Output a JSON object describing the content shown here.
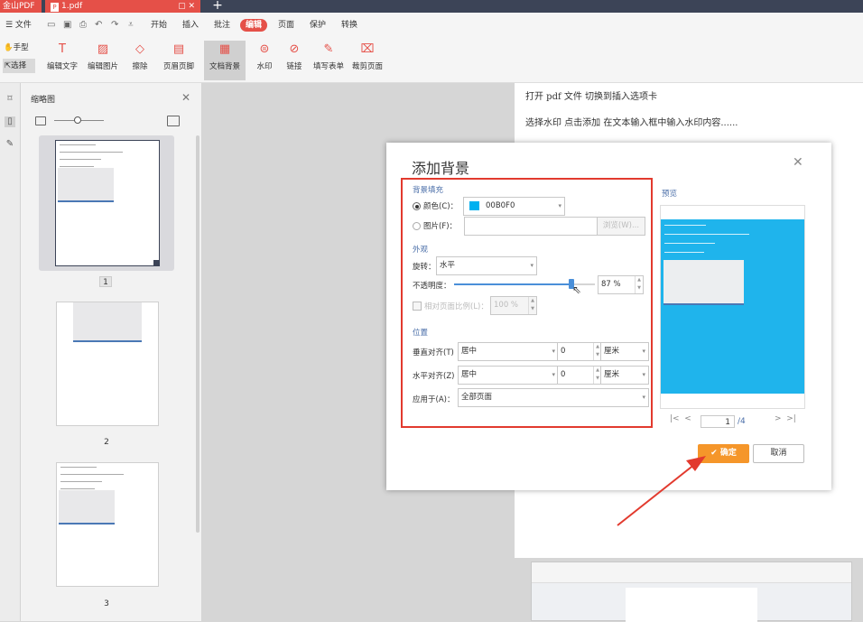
{
  "titlebar": {
    "app_name": "金山PDF",
    "file_name": "1.pdf",
    "file_icon": "P",
    "window_controls": "▢ ✕",
    "new_tab": "+"
  },
  "menubar": {
    "file_menu": "☰ 文件",
    "items": [
      "开始",
      "插入",
      "批注",
      "编辑",
      "页面",
      "保护",
      "转换"
    ]
  },
  "ribbon": {
    "hand": "手型",
    "select": "选择",
    "buttons": [
      "编辑文字",
      "编辑图片",
      "擦除",
      "页眉页脚",
      "文档背景",
      "水印",
      "链接",
      "填写表单",
      "裁剪页面"
    ]
  },
  "thumbnails": {
    "title": "缩略图",
    "pages": [
      "1",
      "2",
      "3"
    ]
  },
  "document": {
    "line1": "打开 pdf 文件  切换到插入选项卡",
    "line2": "选择水印    点击添加  在文本输入框中输入水印内容......"
  },
  "dialog": {
    "title": "添加背景",
    "fill_section": "背景填充",
    "color_label": "颜色(C)：",
    "color_value": "00B0F0",
    "color_hex": "#00B0F0",
    "image_label": "图片(F)：",
    "browse_label": "浏览(W)...",
    "appearance_section": "外观",
    "rotate_label": "旋转：",
    "rotate_value": "水平",
    "opacity_label": "不透明度：",
    "opacity_value": "87 %",
    "opacity_fraction": 0.87,
    "relative_label": "相对页面比例(L)：",
    "relative_value": "100 %",
    "position_section": "位置",
    "valign_label": "垂直对齐(T)",
    "valign_value": "居中",
    "valign_offset": "0",
    "valign_unit": "厘米",
    "halign_label": "水平对齐(Z)",
    "halign_value": "居中",
    "halign_offset": "0",
    "halign_unit": "厘米",
    "apply_label": "应用于(A)：",
    "apply_value": "全部页面",
    "preview_label": "预览",
    "page_current": "1",
    "page_total": "/4",
    "ok_label": "确定",
    "cancel_label": "取消"
  },
  "colors": {
    "accent": "#e55048",
    "highlight_box": "#e23a2e",
    "background_fill": "#00B0F0",
    "ok_button": "#f5962a"
  }
}
